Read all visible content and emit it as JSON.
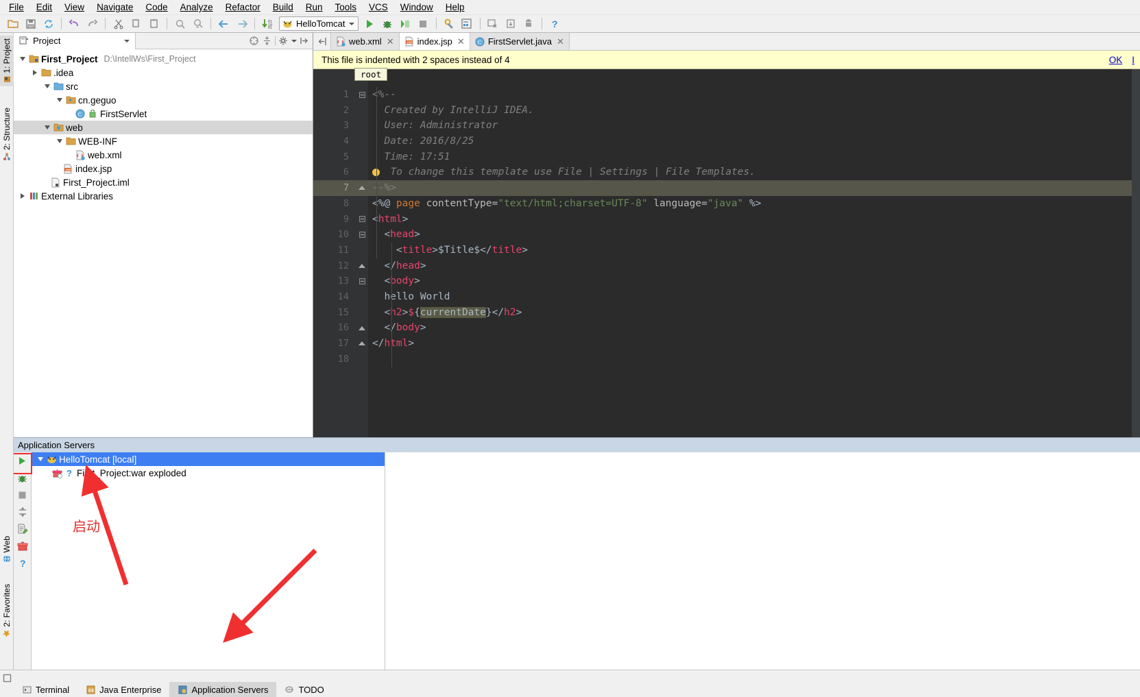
{
  "menubar": {
    "items": [
      "File",
      "Edit",
      "View",
      "Navigate",
      "Code",
      "Analyze",
      "Refactor",
      "Build",
      "Run",
      "Tools",
      "VCS",
      "Window",
      "Help"
    ]
  },
  "toolbar": {
    "run_config": "HelloTomcat",
    "icons": [
      "open-folder-icon",
      "save-all-icon",
      "sync-icon",
      "undo-icon",
      "redo-icon",
      "cut-icon",
      "copy-icon",
      "paste-icon",
      "find-icon",
      "replace-icon",
      "back-icon",
      "forward-icon",
      "compile-icon",
      "run-icon",
      "debug-icon",
      "run-coverage-icon",
      "stop-icon",
      "settings-icon",
      "project-structure-icon",
      "sdk-manager-icon",
      "avd-manager-icon",
      "android-icon",
      "help-icon"
    ]
  },
  "left_strip": {
    "items": [
      {
        "label": "1: Project",
        "icon": "project-icon",
        "active": true
      },
      {
        "label": "2: Structure",
        "icon": "structure-icon",
        "active": false
      },
      {
        "label": "Web",
        "icon": "web-icon",
        "active": false
      },
      {
        "label": "2: Favorites",
        "icon": "favorites-star-icon",
        "active": false
      }
    ]
  },
  "project_panel": {
    "tab_title": "Project",
    "tab_icon": "project-view-icon",
    "tools": [
      "collapse-all-icon",
      "expand-all-icon",
      "gear-icon",
      "hide-icon"
    ],
    "tree": [
      {
        "depth": 0,
        "twist": "down",
        "icon": "module-icon",
        "label": "First_Project",
        "bold": true,
        "path": "D:\\IntellWs\\First_Project",
        "selected": false
      },
      {
        "depth": 1,
        "twist": "right",
        "icon": "folder-icon",
        "label": ".idea",
        "bold": false,
        "path": "",
        "selected": false
      },
      {
        "depth": 1,
        "twist": "down",
        "icon": "source-folder-icon",
        "label": "src",
        "bold": false,
        "path": "",
        "selected": false
      },
      {
        "depth": 2,
        "twist": "down",
        "icon": "package-icon",
        "label": "cn.geguo",
        "bold": false,
        "path": "",
        "selected": false
      },
      {
        "depth": 3,
        "twist": "none",
        "icon": "class-icon",
        "label": "FirstServlet",
        "bold": false,
        "path": "",
        "selected": false
      },
      {
        "depth": 1,
        "twist": "down",
        "icon": "web-folder-icon",
        "label": "web",
        "bold": false,
        "path": "",
        "selected": true
      },
      {
        "depth": 2,
        "twist": "down",
        "icon": "folder-icon",
        "label": "WEB-INF",
        "bold": false,
        "path": "",
        "selected": false
      },
      {
        "depth": 3,
        "twist": "none",
        "icon": "xml-file-icon",
        "label": "web.xml",
        "bold": false,
        "path": "",
        "selected": false
      },
      {
        "depth": 2,
        "twist": "none",
        "icon": "jsp-file-icon",
        "label": "index.jsp",
        "bold": false,
        "path": "",
        "selected": false
      },
      {
        "depth": 1,
        "twist": "none",
        "icon": "iml-file-icon",
        "label": "First_Project.iml",
        "bold": false,
        "path": "",
        "selected": false
      },
      {
        "depth": 0,
        "twist": "right",
        "icon": "library-icon",
        "label": "External Libraries",
        "bold": false,
        "path": "",
        "selected": false
      }
    ]
  },
  "editor": {
    "tabs": [
      {
        "label": "web.xml",
        "icon": "xml-file-icon",
        "active": false
      },
      {
        "label": "index.jsp",
        "icon": "jsp-file-icon",
        "active": true
      },
      {
        "label": "FirstServlet.java",
        "icon": "class-icon",
        "active": false
      }
    ],
    "notice": {
      "message": "This file is indented with 2 spaces instead of 4",
      "ok_label": "OK",
      "second_label": "I"
    },
    "breadcrumb": "root",
    "current_line": 7,
    "lines": [
      {
        "n": 1,
        "fold": "open-top"
      },
      {
        "n": 2,
        "fold": "none"
      },
      {
        "n": 3,
        "fold": "none"
      },
      {
        "n": 4,
        "fold": "none"
      },
      {
        "n": 5,
        "fold": "none"
      },
      {
        "n": 6,
        "fold": "none"
      },
      {
        "n": 7,
        "fold": "close-bottom"
      },
      {
        "n": 8,
        "fold": "none"
      },
      {
        "n": 9,
        "fold": "open-top"
      },
      {
        "n": 10,
        "fold": "open-top"
      },
      {
        "n": 11,
        "fold": "none"
      },
      {
        "n": 12,
        "fold": "close-bottom"
      },
      {
        "n": 13,
        "fold": "open-top"
      },
      {
        "n": 14,
        "fold": "none"
      },
      {
        "n": 15,
        "fold": "none"
      },
      {
        "n": 16,
        "fold": "close-bottom"
      },
      {
        "n": 17,
        "fold": "close-bottom"
      },
      {
        "n": 18,
        "fold": "none"
      }
    ],
    "source_text": [
      "<%--",
      "  Created by IntelliJ IDEA.",
      "  User: Administrator",
      "  Date: 2016/8/25",
      "  Time: 17:51",
      "  To change this template use File | Settings | File Templates.",
      "--%>",
      "<%@ page contentType=\"text/html;charset=UTF-8\" language=\"java\" %>",
      "<html>",
      "  <head>",
      "    <title>$Title$</title>",
      "  </head>",
      "  <body>",
      "  hello World",
      "  <h2>${currentDate}</h2>",
      "  </body>",
      "</html>",
      ""
    ]
  },
  "servers": {
    "panel_title": "Application Servers",
    "toolbar_icons": [
      "run-icon",
      "debug-icon",
      "stop-icon",
      "update-icon",
      "edit-config-icon",
      "deploy-icon",
      "help-icon"
    ],
    "tree": [
      {
        "depth": 0,
        "twist": "down",
        "icon": "tomcat-icon",
        "label": "HelloTomcat [local]",
        "selected": true
      },
      {
        "depth": 1,
        "twist": "none",
        "icon": "artifact-icon",
        "label": "First_Project:war exploded",
        "selected": false,
        "status_icon": "question-icon"
      }
    ],
    "annotation_cn": "启动"
  },
  "bottom_bar": {
    "tabs": [
      {
        "label": "Terminal",
        "icon": "terminal-icon",
        "active": false
      },
      {
        "label": "Java Enterprise",
        "icon": "java-ee-icon",
        "active": false
      },
      {
        "label": "Application Servers",
        "icon": "app-servers-icon",
        "active": true
      },
      {
        "label": "TODO",
        "icon": "todo-icon",
        "active": false
      }
    ]
  },
  "colors": {
    "accent_blue": "#3d7ff2",
    "notice_bg": "#ffffcc",
    "editor_bg": "#2b2b2b",
    "annotation_red": "#e03030"
  }
}
